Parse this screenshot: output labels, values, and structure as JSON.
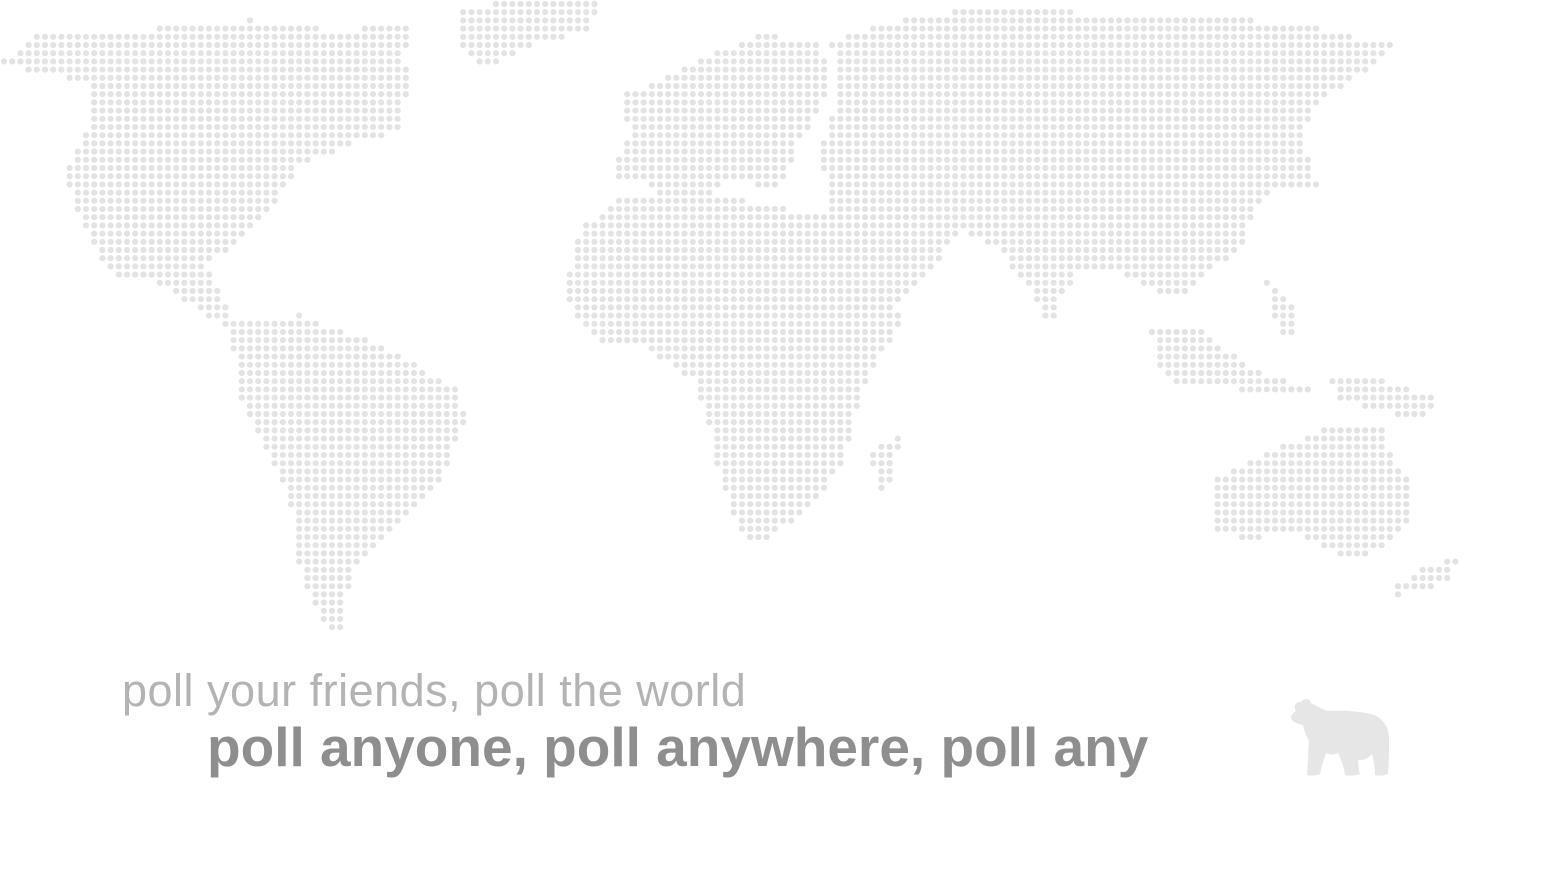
{
  "colors": {
    "background": "#ffffff",
    "map_dot": "#e3e3e3",
    "tagline_text": "#b3b3b3",
    "headline_text": "#8e8e8e",
    "bear": "#e6e6e6"
  },
  "map": {
    "icon": "dotted-world-map"
  },
  "tagline": "poll your friends, poll the world",
  "headline": "poll anyone, poll anywhere, poll any",
  "logo": {
    "icon": "bear-icon"
  }
}
